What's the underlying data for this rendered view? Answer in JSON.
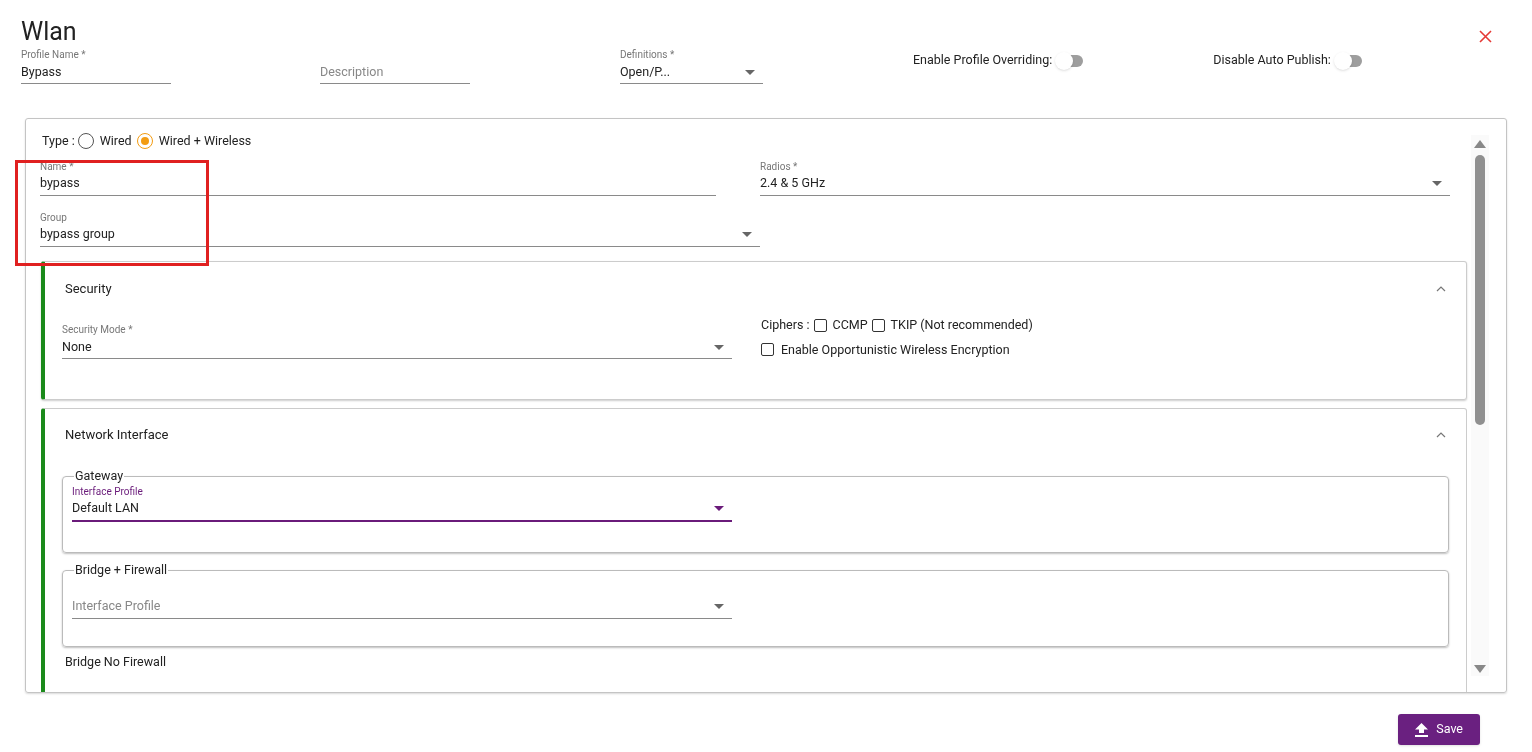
{
  "title": "Wlan",
  "top_fields": [
    {
      "label": "Profile Name *",
      "value": "Bypass"
    },
    {
      "placeholder": "Description"
    },
    {
      "kind": "select",
      "label": "Definitions *",
      "value": "Open/P..."
    }
  ],
  "toggles": [
    {
      "label": "Enable Profile Overriding:",
      "on": false
    },
    {
      "label": "Disable Auto Publish:",
      "on": false
    }
  ],
  "type": {
    "label": "Type :",
    "options": [
      {
        "label": "Wired",
        "selected": false
      },
      {
        "label": "Wired + Wireless",
        "selected": true
      }
    ]
  },
  "name_field": {
    "label": "Name *",
    "value": "bypass"
  },
  "radios_field": {
    "kind": "select",
    "label": "Radios *",
    "value": "2.4 & 5 GHz"
  },
  "group_field": {
    "kind": "select",
    "label": "Group",
    "value": "bypass group"
  },
  "security": {
    "title": "Security",
    "expanded": true,
    "security_mode": {
      "kind": "select",
      "label": "Security Mode *",
      "value": "None"
    },
    "ciphers": {
      "label": "Ciphers :",
      "options": [
        {
          "label": "CCMP",
          "checked": false
        },
        {
          "label": "TKIP (Not recommended)",
          "checked": false
        }
      ]
    },
    "owe": {
      "label": "Enable Opportunistic Wireless Encryption",
      "checked": false
    }
  },
  "network_interface": {
    "title": "Network Interface",
    "expanded": true,
    "groups": [
      {
        "legend": "Gateway",
        "field": {
          "kind": "select",
          "label": "Interface Profile",
          "value": "Default LAN",
          "focused": true
        }
      },
      {
        "legend": "Bridge + Firewall",
        "field": {
          "kind": "select",
          "placeholder": "Interface Profile",
          "focused": false
        }
      },
      {
        "legend": "Bridge No Firewall"
      }
    ]
  },
  "save_button": "Save"
}
